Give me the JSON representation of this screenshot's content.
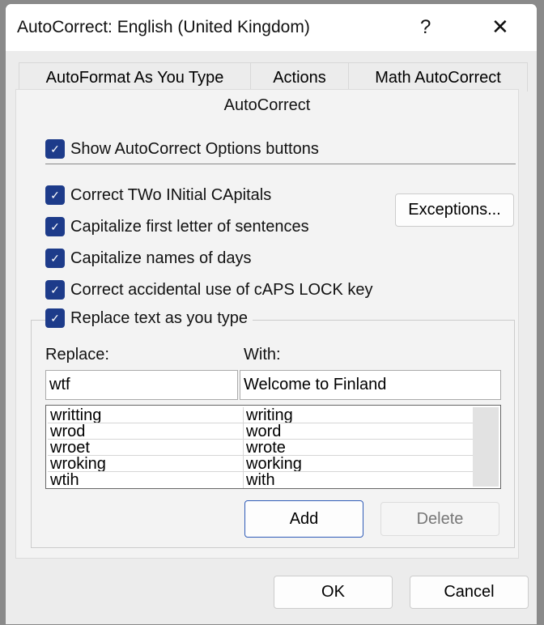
{
  "window": {
    "title": "AutoCorrect: English (United Kingdom)",
    "help_label": "?",
    "close_label": "✕"
  },
  "tabs": [
    {
      "label": "AutoFormat As You Type"
    },
    {
      "label": "Actions"
    },
    {
      "label": "Math AutoCorrect"
    },
    {
      "label": "AutoCorrect",
      "active": true
    }
  ],
  "options": [
    {
      "label": "Show AutoCorrect Options buttons",
      "checked": true
    },
    {
      "label": "Correct TWo INitial CApitals",
      "checked": true
    },
    {
      "label": "Capitalize first letter of sentences",
      "checked": true
    },
    {
      "label": "Capitalize names of days",
      "checked": true
    },
    {
      "label": "Correct accidental use of cAPS LOCK key",
      "checked": true
    },
    {
      "label": "Replace text as you type",
      "checked": true
    }
  ],
  "exceptions_label": "Exceptions...",
  "replace": {
    "replace_label": "Replace:",
    "with_label": "With:",
    "replace_value": "wtf",
    "with_value": "Welcome to Finland"
  },
  "list": [
    {
      "replace": "writting",
      "with": "writing"
    },
    {
      "replace": "wrod",
      "with": "word"
    },
    {
      "replace": "wroet",
      "with": "wrote"
    },
    {
      "replace": "wroking",
      "with": "working"
    },
    {
      "replace": "wtih",
      "with": "with"
    }
  ],
  "add_label": "Add",
  "delete_label": "Delete",
  "ok_label": "OK",
  "cancel_label": "Cancel",
  "colors": {
    "checkbox": "#1d3b8a",
    "add_border": "#2f5bb7"
  }
}
